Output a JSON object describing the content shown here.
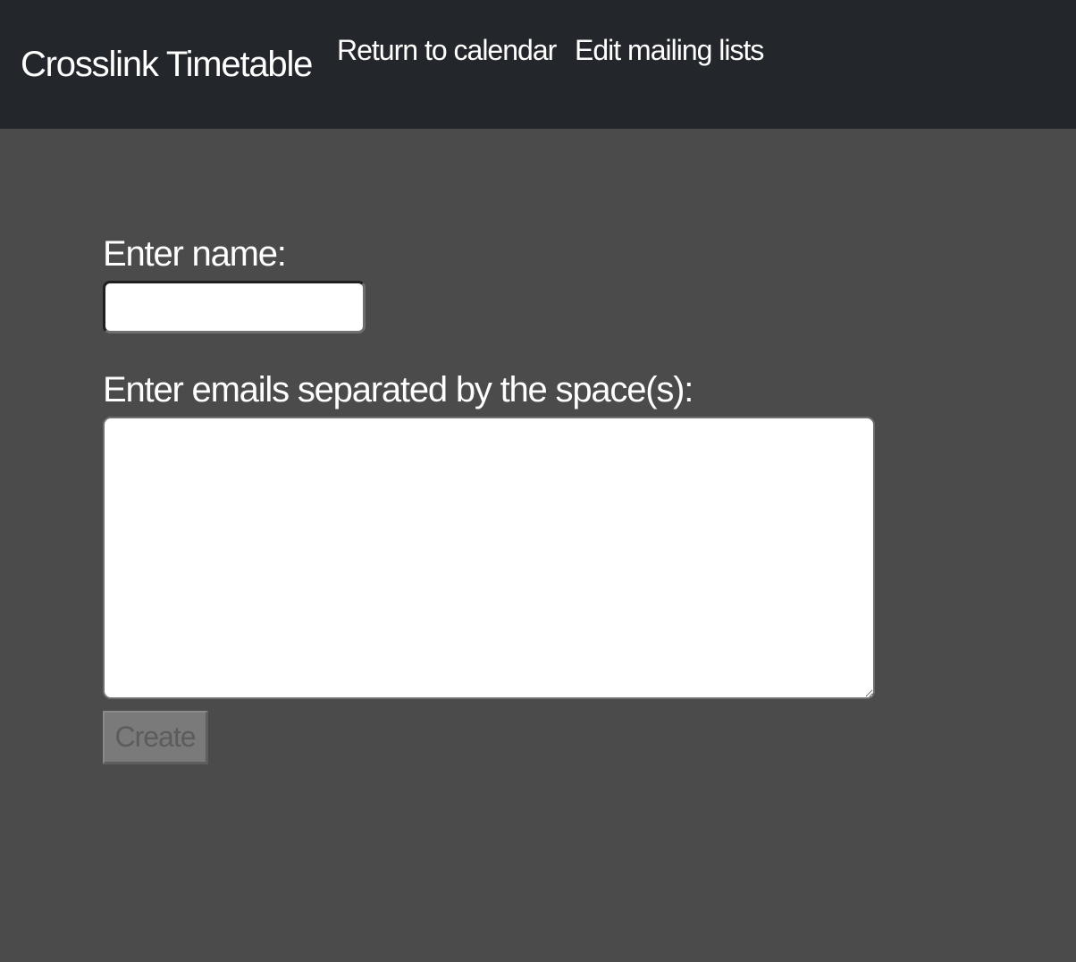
{
  "navbar": {
    "brand": "Crosslink Timetable",
    "links": [
      {
        "label": "Return to calendar"
      },
      {
        "label": "Edit mailing lists"
      }
    ],
    "background_color": "#23262b"
  },
  "form": {
    "name_label": "Enter name:",
    "name_value": "",
    "emails_label": "Enter emails separated by the space(s):",
    "emails_value": "",
    "create_label": "Create",
    "create_disabled": true
  },
  "page": {
    "background_color": "#4b4b4b"
  }
}
